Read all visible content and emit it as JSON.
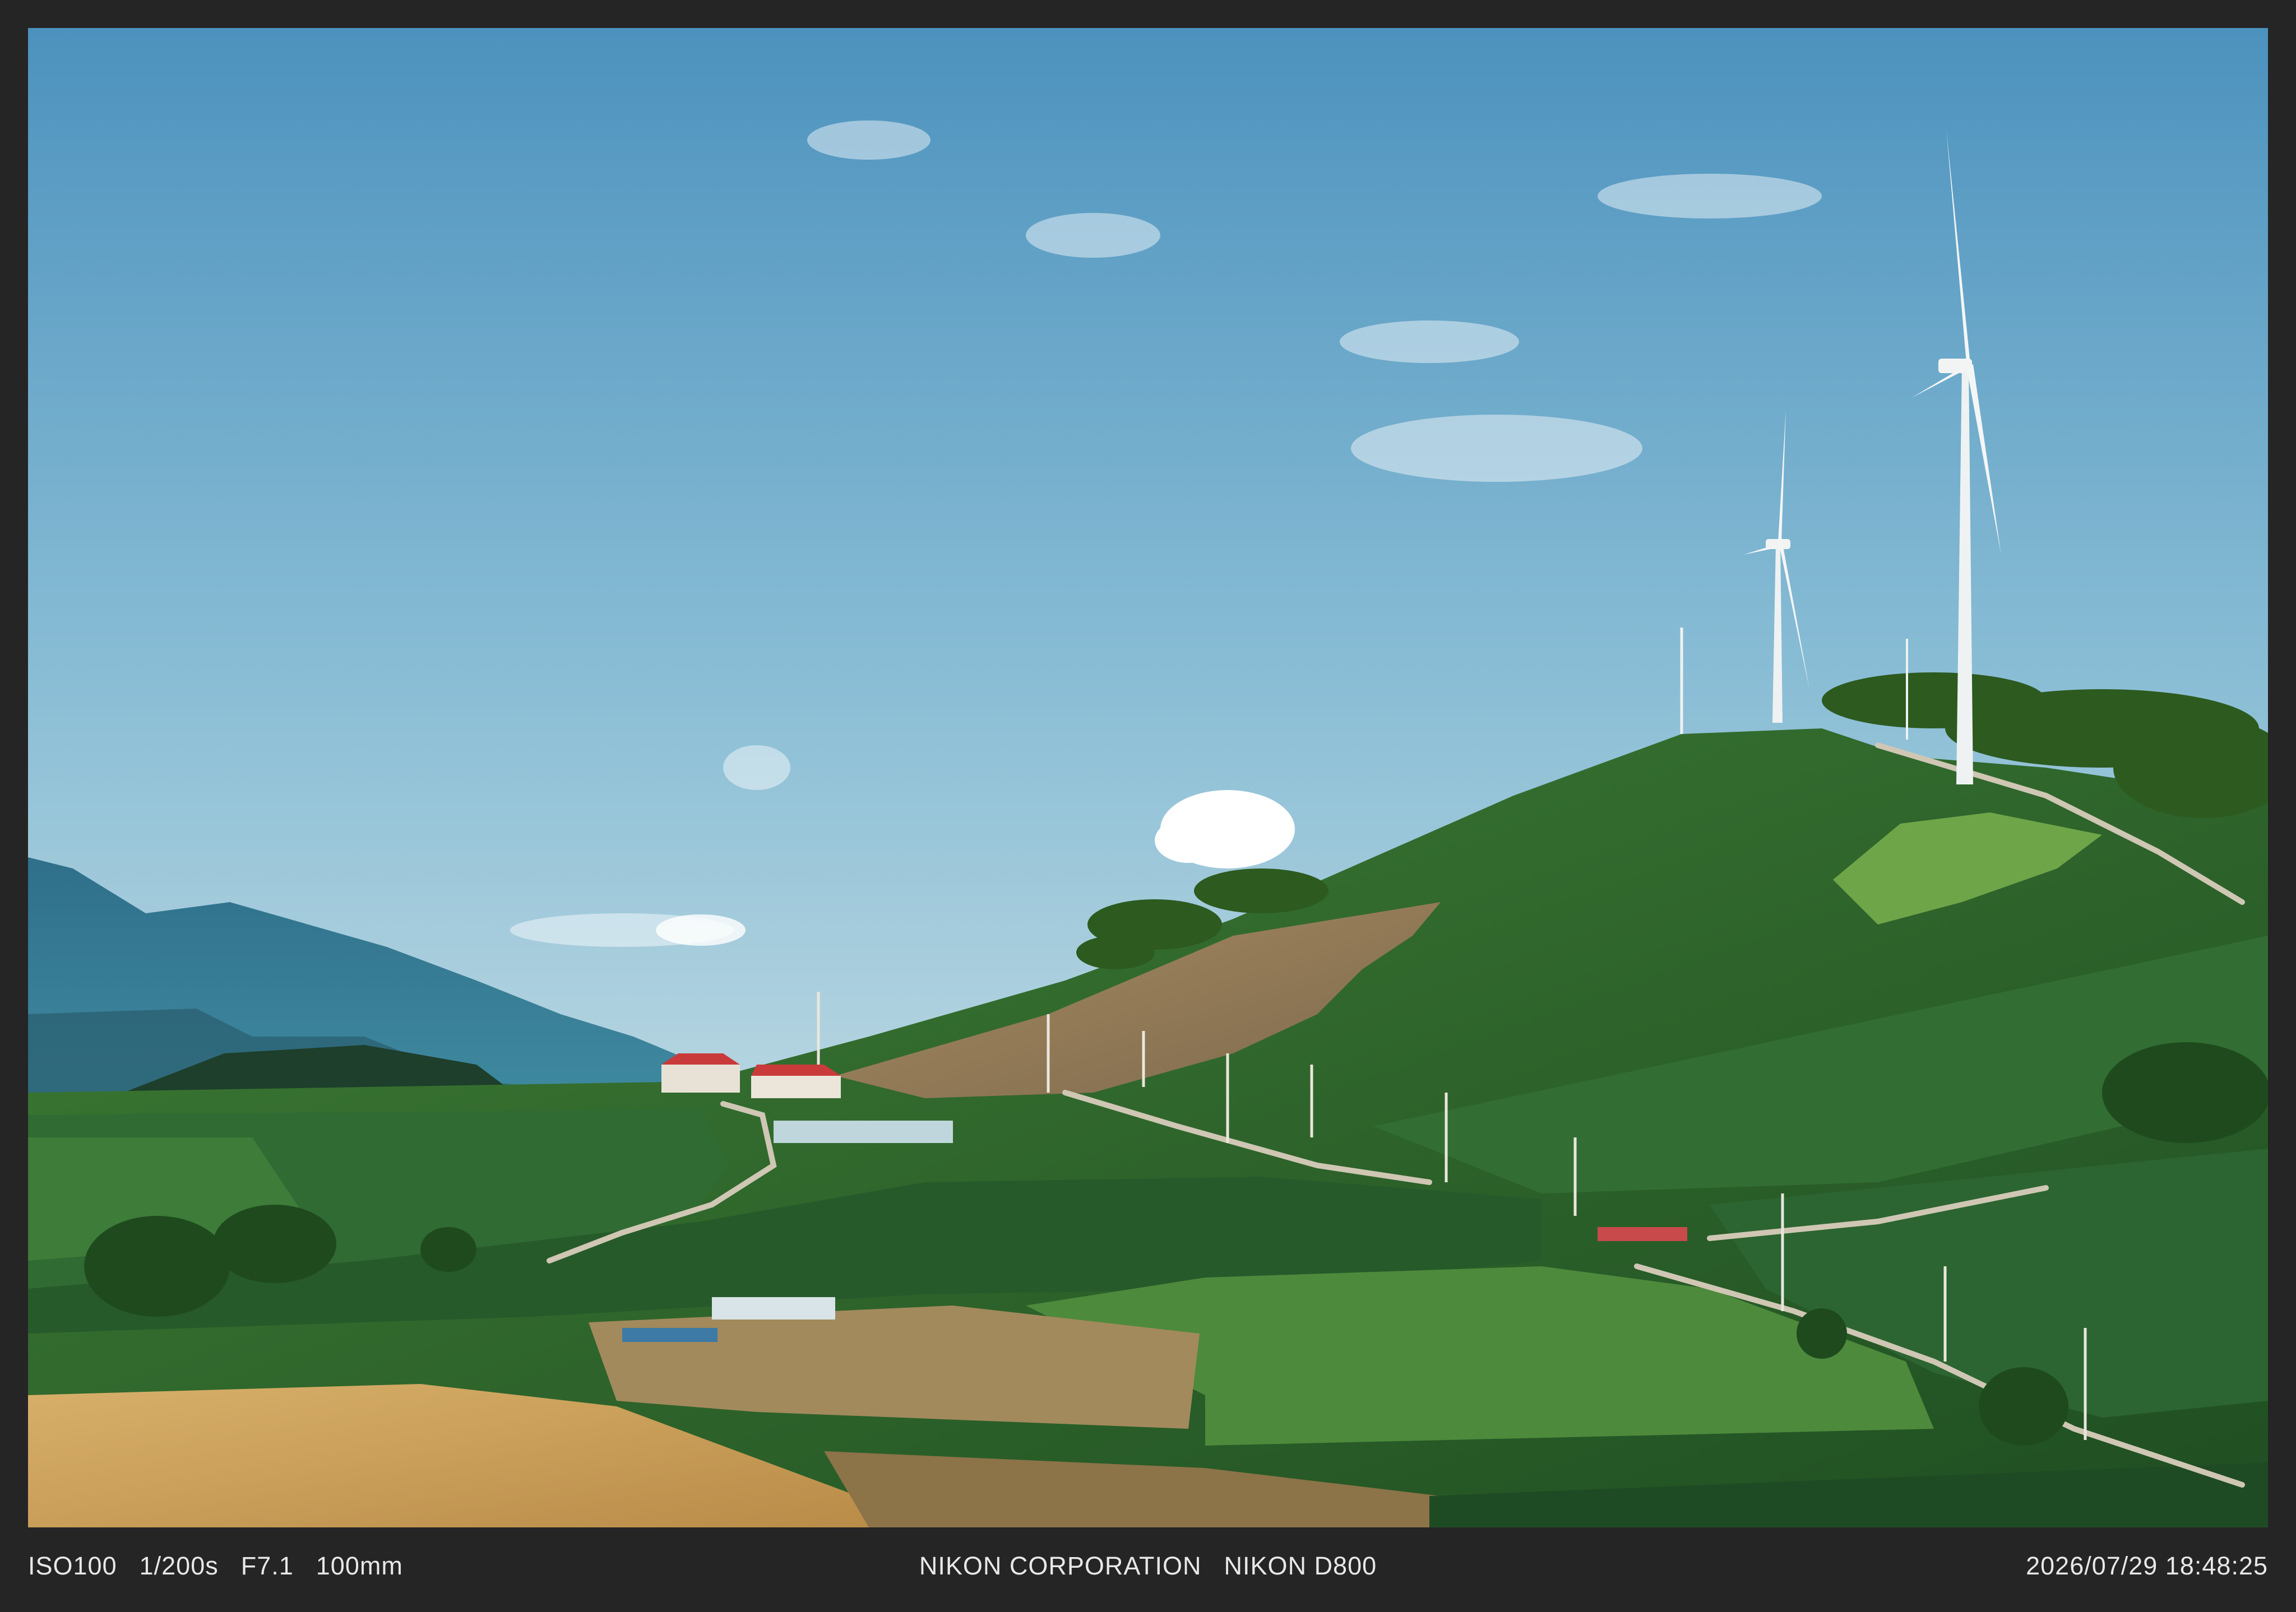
{
  "exif": {
    "iso": "ISO100",
    "shutter": "1/200s",
    "aperture": "F7.1",
    "focal_length": "100mm",
    "maker": "NIKON CORPORATION",
    "model": "NIKON D800",
    "datetime": "2026/07/29 18:48:25"
  },
  "colors": {
    "border": "#252525",
    "caption_text": "#e8e8e8",
    "sky_top": "#4f95c0",
    "sky_bottom": "#cfe3ea",
    "hill_green": "#2f6a30",
    "field_gold": "#c7a25e"
  }
}
